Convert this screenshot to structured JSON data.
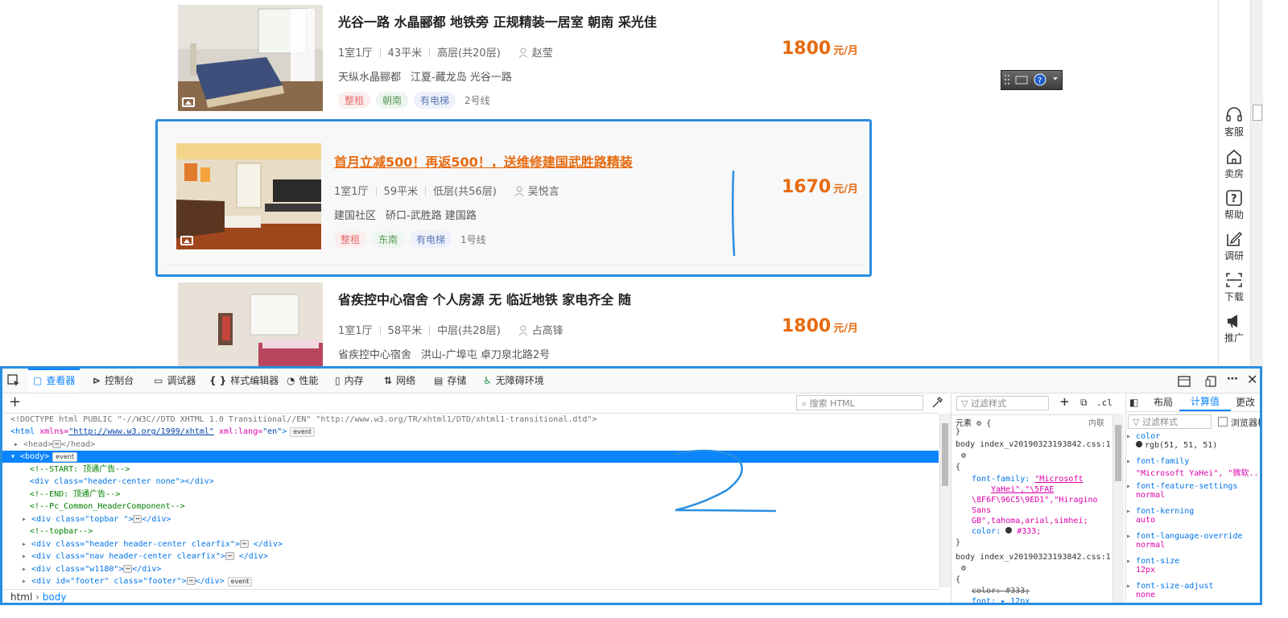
{
  "listings": [
    {
      "title": "光谷一路 水晶郦都 地铁旁 正规精装一居室 朝南 采光佳",
      "layout": "1室1厅",
      "area": "43平米",
      "floor": "高层(共20层)",
      "agent": "赵莹",
      "community": "天纵水晶郦都",
      "location": "江夏-藏龙岛 光谷一路",
      "tags": [
        "整租",
        "朝南",
        "有电梯"
      ],
      "subway": "2号线",
      "price": "1800",
      "price_unit": "元/月"
    },
    {
      "title": "首月立减500！再返500！，送维修建国武胜路精装",
      "layout": "1室1厅",
      "area": "59平米",
      "floor": "低层(共56层)",
      "agent": "吴悦言",
      "community": "建国社区",
      "location": "硚口-武胜路 建国路",
      "tags": [
        "整租",
        "东南",
        "有电梯"
      ],
      "subway": "1号线",
      "price": "1670",
      "price_unit": "元/月"
    },
    {
      "title": "省疾控中心宿舍 个人房源 无 临近地铁 家电齐全 随",
      "layout": "1室1厅",
      "area": "58平米",
      "floor": "中层(共28层)",
      "agent": "占高锋",
      "community": "省疾控中心宿舍",
      "location": "洪山-广埠屯 卓刀泉北路2号",
      "price": "1800",
      "price_unit": "元/月"
    }
  ],
  "side_tools": [
    "客服",
    "卖房",
    "帮助",
    "调研",
    "下载",
    "推广"
  ],
  "annotation_text": "2",
  "devtools": {
    "tabs": [
      {
        "label": "查看器",
        "icon": "inspector-icon"
      },
      {
        "label": "控制台",
        "icon": "console-icon"
      },
      {
        "label": "调试器",
        "icon": "debugger-icon"
      },
      {
        "label": "样式编辑器",
        "icon": "style-editor-icon"
      },
      {
        "label": "性能",
        "icon": "performance-icon"
      },
      {
        "label": "内存",
        "icon": "memory-icon"
      },
      {
        "label": "网络",
        "icon": "network-icon"
      },
      {
        "label": "存储",
        "icon": "storage-icon"
      },
      {
        "label": "无障碍环境",
        "icon": "accessibility-icon"
      }
    ],
    "search_html_placeholder": "搜索 HTML",
    "filter_styles_placeholder": "过滤样式",
    "cls_label": ".cls",
    "side_tabs": [
      "布局",
      "计算值",
      "更改"
    ],
    "computed_filter_placeholder": "过滤样式",
    "browser_styles_label": "浏览器样式",
    "html_lines": {
      "doctype": "<!DOCTYPE html PUBLIC \"-//W3C//DTD XHTML 1.0 Transitional//EN\" \"http://www.w3.org/TR/xhtml1/DTD/xhtml1-transitional.dtd\">",
      "html_open_tag": "<html",
      "xmlns_attr": "xmlns=",
      "xmlns_value": "\"http://www.w3.org/1999/xhtml\"",
      "lang_attr": "xml:lang=",
      "lang_value": "\"en\"",
      "tag_close": ">",
      "head_open": "<head>",
      "head_close": "</head>",
      "body_open": "<body>",
      "comment_start": "<!--START: 顶通广告-->",
      "div_header_center": "<div class=\"header-center none\"></div>",
      "comment_end": "<!--END: 顶通广告-->",
      "comment_component": "<!--Pc_Common_HeaderComponent-->",
      "div_topbar_open": "<div class=\"topbar \">",
      "div_close": "</div>",
      "comment_topbar": "<!--topbar-->",
      "div_header_open": "<div class=\"header header-center clearfix\">",
      "div_nav_open": "<div class=\"nav header-center clearfix\">",
      "div_w1180_open": "<div class=\"w1180\">",
      "div_footer_open": "<div id=\"footer\" class=\"footer\">",
      "badge_event": "event",
      "ellipsis": "⋯"
    },
    "breadcrumb": [
      "html",
      "body"
    ],
    "rules": {
      "element_label": "元素",
      "element_rule": "{",
      "rule_close": "}",
      "inline_label": "内联",
      "source1": "body  index_v20190323193842.css:1",
      "font_family_prop": "font-family:",
      "font_family_val_1": "\"Microsoft",
      "font_family_val_2": "YaHei\",\"\\5FAE",
      "font_family_val_3": "\\8F6F\\96C5\\9ED1\",\"Hiragino",
      "font_family_val_4": "Sans",
      "font_family_val_5": "GB\",tahoma,arial,simhei;",
      "color_prop": "color:",
      "color_val": "#333;",
      "source2": "body  index_v20190323193842.css:1",
      "color_strike": "color: #333;",
      "font_prop": "font: ▸ 12px"
    },
    "computed": [
      {
        "name": "color",
        "value": "rgb(51, 51, 51)"
      },
      {
        "name": "font-family",
        "value": "\"Microsoft YaHei\", \"微软..."
      },
      {
        "name": "font-feature-settings",
        "value": "normal"
      },
      {
        "name": "font-kerning",
        "value": "auto"
      },
      {
        "name": "font-language-override",
        "value": "normal"
      },
      {
        "name": "font-size",
        "value": "12px"
      },
      {
        "name": "font-size-adjust",
        "value": "none"
      }
    ],
    "accent_color": "#0a84ff",
    "annotation_color": "#2a8ee0"
  }
}
